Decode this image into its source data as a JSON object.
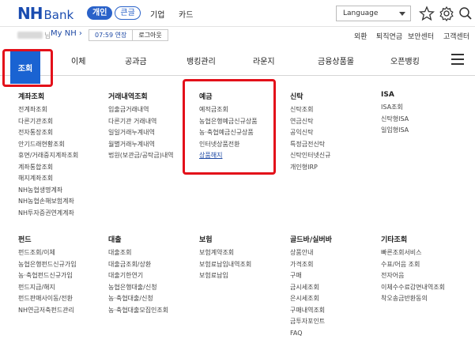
{
  "header": {
    "logo_nh": "NH",
    "logo_bank": "Bank",
    "segments": [
      "개인",
      "큰글"
    ],
    "menu": [
      "기업",
      "카드"
    ],
    "language_label": "Language"
  },
  "subbar": {
    "user_suffix": "님",
    "my_nh": "My NH ›",
    "session_time": "07:59 연장",
    "logout": "로그아웃",
    "utility": [
      "외환",
      "퇴직연금",
      "보안센터",
      "고객센터"
    ]
  },
  "gnb": {
    "home": "조회",
    "items": [
      "이체",
      "공과금",
      "뱅킹관리",
      "라운지",
      "금융상품몰",
      "오픈뱅킹"
    ]
  },
  "mega_menu": [
    {
      "title": "계좌조회",
      "items": [
        "전계좌조회",
        "다른기관조회",
        "전자통장조회",
        "안기드래현황조회",
        "휴면/거래중지계좌조회",
        "계좌통합조회",
        "해지계좌조회",
        "NH농협생명계좌",
        "NH농협손해보험계좌",
        "NH투자증권연계계좌"
      ]
    },
    {
      "title": "거래내역조회",
      "items": [
        "입출금거래내역",
        "다른기관 거래내역",
        "일일거래누계내역",
        "월별거래누계내역",
        "법원(보관금/공탁금)내역"
      ]
    },
    {
      "title": "예금",
      "items": [
        "예적금조회",
        "농협은행예금신규상품",
        "농·축협예금신규상품",
        "인터넷상품전환",
        "상품해지"
      ],
      "highlight": "상품해지"
    },
    {
      "title": "신탁",
      "items": [
        "신탁조회",
        "연금신탁",
        "공익신탁",
        "특정금전신탁",
        "신탁인터넷신규",
        "개인형IRP"
      ]
    },
    {
      "title": "ISA",
      "items": [
        "ISA조회",
        "신탁형ISA",
        "일임형ISA"
      ]
    },
    {
      "title": "펀드",
      "items": [
        "펀드조회/이체",
        "농협은행펀드신규가입",
        "농·축협펀드신규가입",
        "펀드지급/해지",
        "펀드판매사이동/전환",
        "NH연금저축펀드관리"
      ]
    },
    {
      "title": "대출",
      "items": [
        "대출조회",
        "대출금조회/상환",
        "대출기한연기",
        "농협은행대출/신청",
        "농·축협대출/신청",
        "농·축협대출모집인조회"
      ]
    },
    {
      "title": "보험",
      "items": [
        "보험계약조회",
        "보험료납입내역조회",
        "보험료납입"
      ]
    },
    {
      "title": "골드바/실버바",
      "items": [
        "상품안내",
        "가격조회",
        "구매",
        "금시세조회",
        "은시세조회",
        "구매내역조회",
        "금투자포인트",
        "FAQ"
      ]
    },
    {
      "title": "기타조회",
      "items": [
        "빠른조회서비스",
        "수표/어음 조회",
        "전자어음",
        "이체수수료감면내역조회",
        "착오송금반환동의"
      ]
    }
  ],
  "colors": {
    "brand_blue": "#1a63d2",
    "logo_blue": "#1a4cb0",
    "highlight_red": "#e3101a"
  }
}
